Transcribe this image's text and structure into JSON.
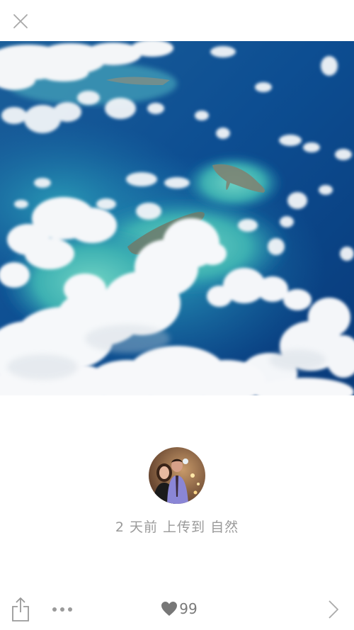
{
  "header": {
    "close_icon": "close-icon"
  },
  "photo": {
    "subject": "aerial-islands-clouds",
    "colors": {
      "deep_ocean": "#0b3f86",
      "mid_ocean": "#1573a7",
      "shallow": "#42b9b5",
      "cloud": "#f4f6f8"
    }
  },
  "uploader": {
    "avatar_icon": "avatar"
  },
  "upload_info": {
    "text": "2 天前 上传到 自然"
  },
  "toolbar": {
    "share_icon": "share-icon",
    "more_icon": "more-icon",
    "like_icon": "heart-icon",
    "like_count": "99",
    "next_icon": "chevron-right-icon"
  }
}
